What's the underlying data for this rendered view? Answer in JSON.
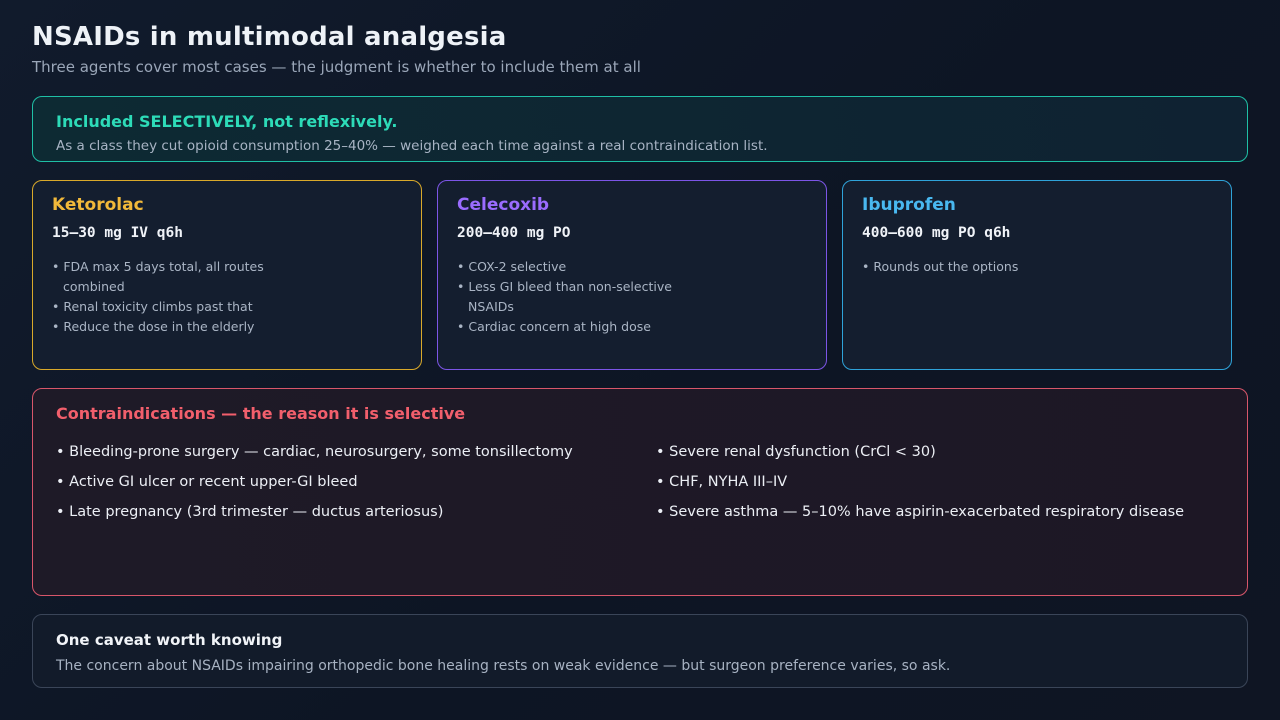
{
  "header": {
    "title": "NSAIDs in multimodal analgesia",
    "subtitle": "Three agents cover most cases — the judgment is whether to include them at all"
  },
  "callout": {
    "heading": "Included SELECTIVELY, not reflexively.",
    "body": "As a class they cut opioid consumption 25–40% — weighed each time against a real contraindication list."
  },
  "agents": [
    {
      "name": "Ketorolac",
      "dose": "15–30 mg IV q6h",
      "accent": "#f2b93a",
      "points": [
        "• FDA max 5 days total, all routes combined",
        "• Renal toxicity climbs past that",
        "• Reduce the dose in the elderly"
      ]
    },
    {
      "name": "Celecoxib",
      "dose": "200–400 mg PO",
      "accent": "#9a6cff",
      "points": [
        "• COX-2 selective",
        "• Less GI bleed than non-selective NSAIDs",
        "• Cardiac concern at high dose"
      ]
    },
    {
      "name": "Ibuprofen",
      "dose": "400–600 mg PO q6h",
      "accent": "#49b8f0",
      "points": [
        "• Rounds out the options"
      ]
    }
  ],
  "contraindications": {
    "heading": "Contraindications — the reason it is selective",
    "left": [
      "• Bleeding-prone surgery — cardiac, neurosurgery, some tonsillectomy",
      "• Active GI ulcer or recent upper-GI bleed",
      "• Late pregnancy (3rd trimester — ductus arteriosus)"
    ],
    "right": [
      "• Severe renal dysfunction (CrCl < 30)",
      "• CHF, NYHA III–IV",
      "• Severe asthma — 5–10% have aspirin-exacerbated respiratory disease"
    ]
  },
  "caveat": {
    "heading": "One caveat worth knowing",
    "body": "The concern about NSAIDs impairing orthopedic bone healing rests on weak evidence — but surgeon preference varies, so ask."
  }
}
